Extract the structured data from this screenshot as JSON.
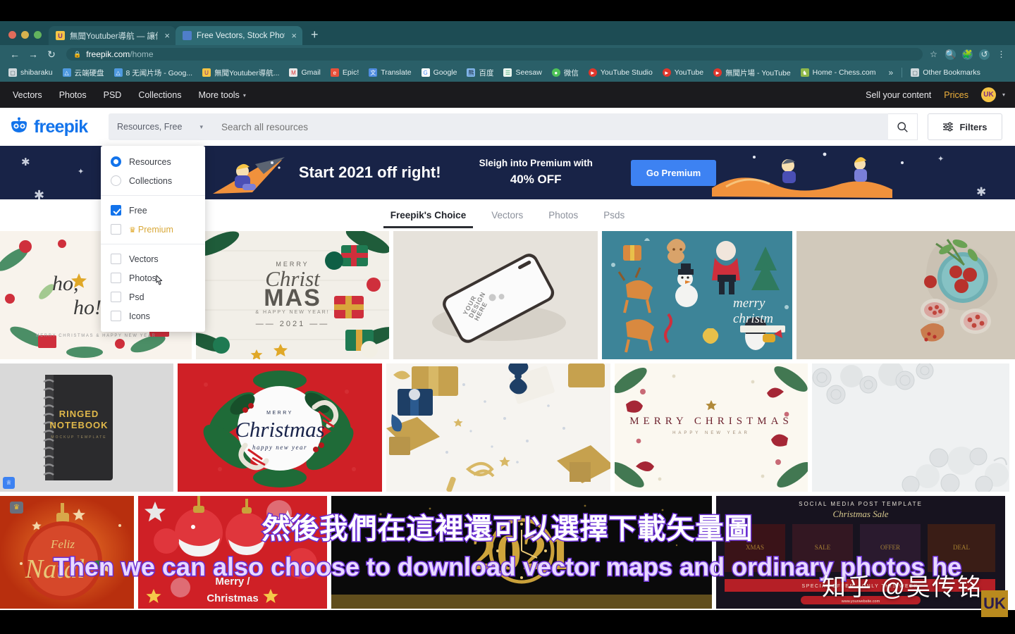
{
  "browser": {
    "tabs": [
      {
        "title": "無聞Youtuber導航 — 讓你專注",
        "favicon": "uk-favicon",
        "active": false,
        "close": "×"
      },
      {
        "title": "Free Vectors, Stock Photos & P",
        "favicon": "freepik-favicon",
        "active": true,
        "close": "×"
      }
    ],
    "new_tab_label": "+",
    "nav": {
      "back": "←",
      "forward": "→",
      "reload": "↻"
    },
    "omnibox": {
      "lock_icon": "lock-icon",
      "host": "freepik.com",
      "path": "/home"
    },
    "toolbar_icons": [
      "star-icon",
      "search-circle-icon",
      "extensions-puzzle-icon",
      "history-icon",
      "menu-kebab-icon"
    ],
    "bookmarks": [
      {
        "label": "shibaraku",
        "icon": "folder-icon",
        "color": "#cfd8dc"
      },
      {
        "label": "云端硬盘",
        "icon": "drive-icon",
        "color": "#4f9ae0"
      },
      {
        "label": "8 无闻片场 - Goog...",
        "icon": "drive-icon",
        "color": "#4f9ae0"
      },
      {
        "label": "無聞Youtuber導航...",
        "icon": "uk-icon",
        "color": "#f6c445"
      },
      {
        "label": "Gmail",
        "icon": "gmail-icon",
        "color": "#e4e4e4"
      },
      {
        "label": "Epic!",
        "icon": "epic-icon",
        "color": "#e8503a"
      },
      {
        "label": "Translate",
        "icon": "translate-icon",
        "color": "#4f8ce0"
      },
      {
        "label": "Google",
        "icon": "google-icon",
        "color": "#ffffff"
      },
      {
        "label": "百度",
        "icon": "baidu-icon",
        "color": "#4a8fe0"
      },
      {
        "label": "Seesaw",
        "icon": "seesaw-icon",
        "color": "#4db37a"
      },
      {
        "label": "微信",
        "icon": "wechat-icon",
        "color": "#4ec257"
      },
      {
        "label": "YouTube Studio",
        "icon": "youtube-icon",
        "color": "#e0362c"
      },
      {
        "label": "YouTube",
        "icon": "youtube-icon",
        "color": "#e0362c"
      },
      {
        "label": "無聞片場 - YouTube",
        "icon": "youtube-icon",
        "color": "#e0362c"
      },
      {
        "label": "Home - Chess.com",
        "icon": "chess-icon",
        "color": "#8fb84a"
      }
    ],
    "bookmarks_overflow": "»",
    "other_bookmarks": {
      "label": "Other Bookmarks",
      "icon": "folder-icon"
    }
  },
  "topnav": {
    "items": [
      "Vectors",
      "Photos",
      "PSD",
      "Collections",
      "More tools"
    ],
    "more_tools_caret": "▾",
    "sell": "Sell your content",
    "prices": "Prices",
    "avatar_initials": "UK",
    "avatar_caret": "▾",
    "avatar_color": "#f6c445"
  },
  "header": {
    "logo_text": "freepik",
    "logo_color": "#1273eb",
    "select_value": "Resources, Free",
    "select_caret": "▾",
    "search_placeholder": "Search all resources",
    "search_value": "",
    "search_icon": "search-icon",
    "filters_label": "Filters",
    "filters_icon": "sliders-icon"
  },
  "dropdown": {
    "open": true,
    "groups": [
      {
        "type": "radio",
        "options": [
          {
            "label": "Resources",
            "selected": true
          },
          {
            "label": "Collections",
            "selected": false
          }
        ]
      },
      {
        "type": "checkbox",
        "options": [
          {
            "label": "Free",
            "checked": true,
            "premium": false
          },
          {
            "label": "Premium",
            "checked": false,
            "premium": true,
            "crown": "♛"
          }
        ]
      },
      {
        "type": "checkbox",
        "options": [
          {
            "label": "Vectors",
            "checked": false
          },
          {
            "label": "Photos",
            "checked": false,
            "hovered": true
          },
          {
            "label": "Psd",
            "checked": false
          },
          {
            "label": "Icons",
            "checked": false
          }
        ]
      }
    ]
  },
  "banner": {
    "headline": "Start 2021 off right!",
    "sub_line1": "Sleigh into Premium with",
    "sub_line2": "40% OFF",
    "cta": "Go Premium",
    "bg_color": "#182347",
    "cta_color": "#3d82f2"
  },
  "content_tabs": [
    {
      "label": "Freepik's Choice",
      "active": true
    },
    {
      "label": "Vectors",
      "active": false
    },
    {
      "label": "Photos",
      "active": false
    },
    {
      "label": "Psds",
      "active": false
    }
  ],
  "grid": {
    "row1": [
      {
        "name": "ho-ho-christmas-frame",
        "caption": "ho,\nho!",
        "sub": "MERRY CHRISTMAS & HAPPY NEW YEAR",
        "bg": "#f7f2ea"
      },
      {
        "name": "merry-christmas-wood-flatlay",
        "caption": "MERRY Christ MAS",
        "sub": "& HAPPY NEW YEAR! — 2021",
        "bg": "#f3f1ec"
      },
      {
        "name": "phone-mockup",
        "caption": "YOUR DESIGN HERE",
        "bg": "#e5e1da"
      },
      {
        "name": "christmas-doodle-pattern",
        "caption": "merry christmas",
        "bg": "#3c8196"
      },
      {
        "name": "pomegranate-flatlay",
        "caption": "",
        "bg": "#cdc5b8"
      }
    ],
    "row2": [
      {
        "name": "ringed-notebook-mockup",
        "caption": "RINGED NOTEBOOK",
        "sub": "MOCKUP TEMPLATE",
        "bg": "#d8d8d8",
        "badge": "premium"
      },
      {
        "name": "christmas-wreath-red-card",
        "caption": "MERRY Christmas",
        "sub": "happy new year",
        "bg": "#cf2026"
      },
      {
        "name": "gold-blue-gifts-flatlay",
        "caption": "",
        "bg": "#f5f3ef"
      },
      {
        "name": "merry-christmas-floral-card",
        "caption": "MERRY CHRISTMAS",
        "sub": "HAPPY NEW YEAR",
        "bg": "#faf7ef"
      },
      {
        "name": "white-baubles-pinecones",
        "caption": "",
        "bg": "#eef0f1"
      }
    ],
    "row3": [
      {
        "name": "feliz-natal-bauble",
        "caption": "Feliz Natal",
        "bg": "#c43512",
        "badge": "crown"
      },
      {
        "name": "merry-christmas-red-baubles",
        "caption": "Merry / Christmas",
        "bg": "#cf2026"
      },
      {
        "name": "new-year-2021-gold-clock",
        "caption": "2021",
        "bg": "#0b0b0b"
      },
      {
        "name": "social-media-post-template",
        "caption": "SOCIAL MEDIA POST TEMPLATE",
        "sub": "Christmas Sale",
        "bg": "#15121f"
      }
    ]
  },
  "subtitles": {
    "chinese": "然後我們在這裡還可以選擇下載矢量圖",
    "english": "Then we can also choose to download vector maps and ordinary photos he",
    "stroke_color": "#6b2fd4",
    "fill_color": "#ffffff"
  },
  "watermark": {
    "text": "知乎 @吴传铭",
    "logo_initials": "UK",
    "logo_color": "#b98a1e"
  }
}
